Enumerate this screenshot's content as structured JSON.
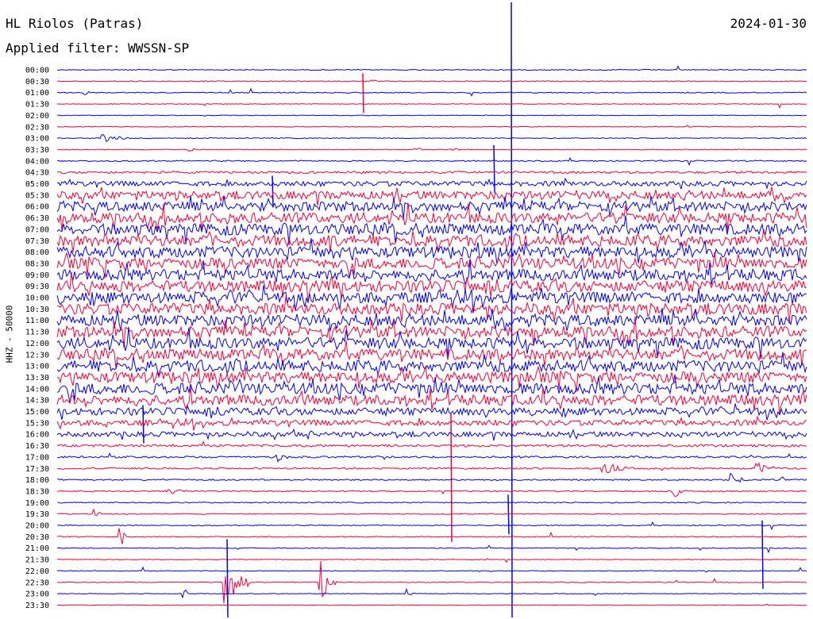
{
  "header": {
    "station": "HL Riolos (Patras)",
    "date": "2024-01-30",
    "filter": "Applied filter: WWSSN-SP"
  },
  "colors": {
    "blue": "#0000ff",
    "red": "#ff0033",
    "background": "#ffffff",
    "text": "#000000"
  },
  "chart_data": {
    "type": "line",
    "ylabel": "HHZ - 50000",
    "xlabel": "",
    "grid": false,
    "row_labels": [
      "00:00",
      "00:30",
      "01:00",
      "01:30",
      "02:00",
      "02:30",
      "03:00",
      "03:30",
      "04:00",
      "04:30",
      "05:00",
      "05:30",
      "06:00",
      "06:30",
      "07:00",
      "07:30",
      "08:00",
      "08:30",
      "09:00",
      "09:30",
      "10:00",
      "10:30",
      "11:00",
      "11:30",
      "12:00",
      "12:30",
      "13:00",
      "13:30",
      "14:00",
      "14:30",
      "15:00",
      "15:30",
      "16:00",
      "16:30",
      "17:00",
      "17:30",
      "18:00",
      "18:30",
      "19:00",
      "19:30",
      "20:00",
      "20:30",
      "21:00",
      "21:30",
      "22:00",
      "22:30",
      "23:00",
      "23:30"
    ],
    "trace_colors": [
      "blue",
      "red"
    ],
    "noise_level": [
      0.6,
      0.5,
      0.6,
      0.4,
      0.4,
      0.4,
      0.5,
      0.5,
      0.8,
      1.5,
      3.0,
      5.0,
      6.0,
      6.5,
      7.0,
      7.0,
      7.0,
      7.0,
      7.0,
      7.0,
      7.0,
      7.0,
      7.0,
      7.0,
      7.0,
      7.0,
      7.0,
      7.0,
      7.0,
      6.5,
      4.5,
      3.5,
      3.0,
      1.6,
      1.2,
      1.0,
      0.9,
      0.8,
      0.7,
      0.6,
      0.6,
      0.6,
      0.5,
      0.5,
      0.5,
      0.5,
      0.4,
      0.4
    ]
  }
}
